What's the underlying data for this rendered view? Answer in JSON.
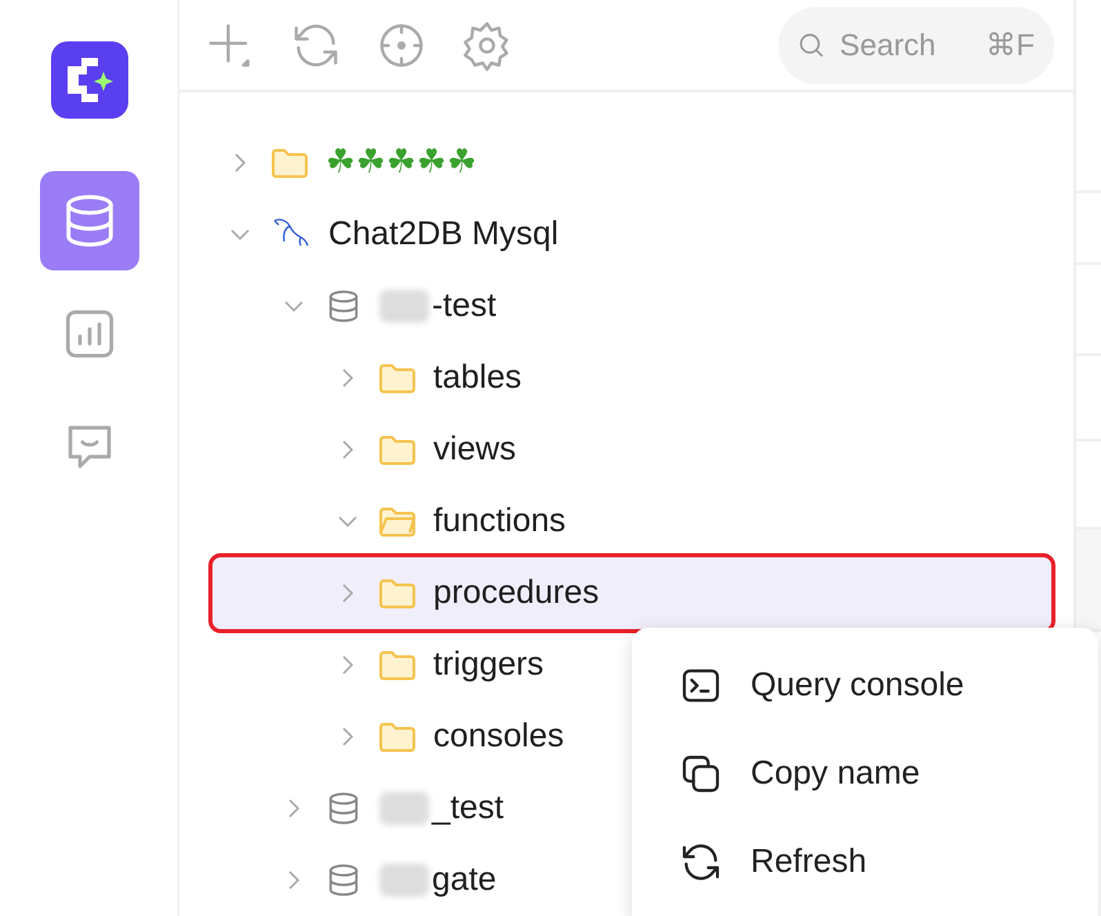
{
  "rail": {
    "items": [
      {
        "selected": true
      },
      {
        "selected": false
      },
      {
        "selected": false
      }
    ]
  },
  "toolbar": {
    "search": {
      "placeholder": "Search",
      "shortcut": "⌘F"
    }
  },
  "tree": [
    {
      "kind": "folder",
      "label": "☘☘☘☘☘",
      "expanded": false,
      "selected": false
    },
    {
      "kind": "connection",
      "label": "Chat2DB Mysql",
      "expanded": true,
      "selected": false,
      "children": [
        {
          "kind": "database",
          "label": "-test",
          "blurred": true,
          "expanded": true,
          "selected": false,
          "children": [
            {
              "kind": "folder",
              "label": "tables",
              "expanded": false,
              "selected": false
            },
            {
              "kind": "folder",
              "label": "views",
              "expanded": false,
              "selected": false
            },
            {
              "kind": "folder",
              "label": "functions",
              "expanded": true,
              "selected": false
            },
            {
              "kind": "folder",
              "label": "procedures",
              "expanded": false,
              "selected": true
            },
            {
              "kind": "folder",
              "label": "triggers",
              "expanded": false,
              "selected": false
            },
            {
              "kind": "folder",
              "label": "consoles",
              "expanded": false,
              "selected": false
            }
          ]
        },
        {
          "kind": "database",
          "label": "_test",
          "blurred": true,
          "expanded": false,
          "selected": false
        },
        {
          "kind": "database",
          "label": "gate",
          "blurred": true,
          "expanded": false,
          "selected": false
        }
      ]
    }
  ],
  "context_menu": [
    {
      "label": "Query console"
    },
    {
      "label": "Copy name"
    },
    {
      "label": "Refresh"
    }
  ]
}
